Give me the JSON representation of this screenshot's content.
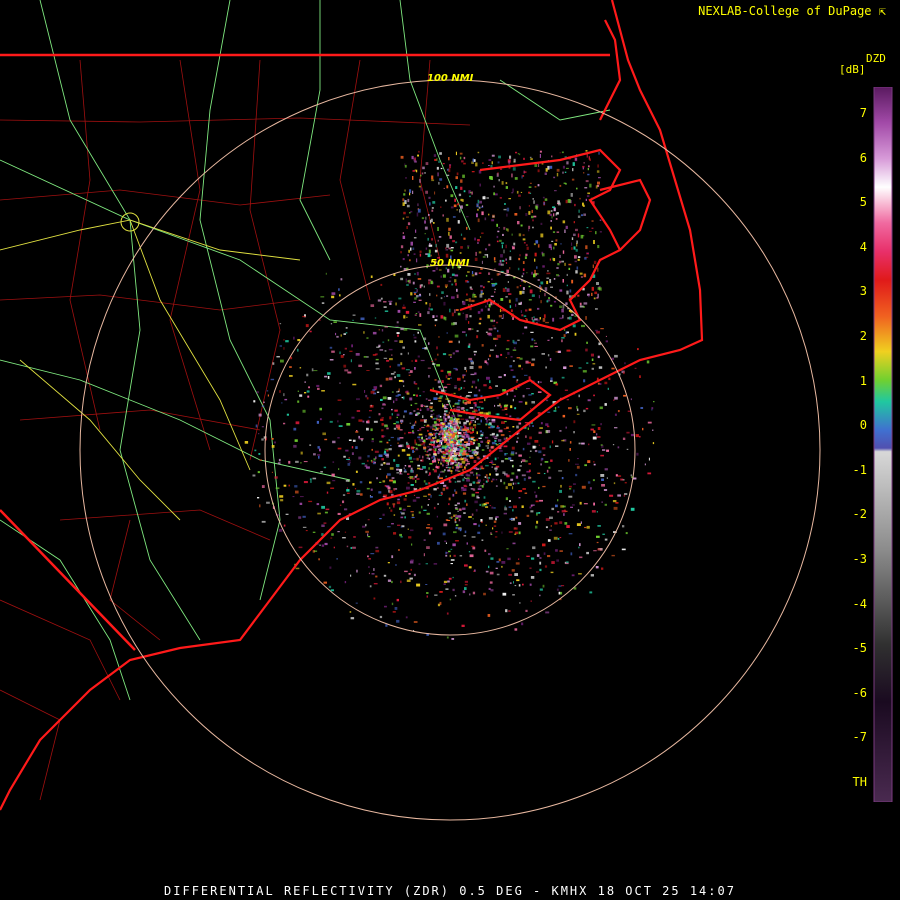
{
  "credit": "NEXLAB-College of DuPage",
  "credit_icon": "cursor-arrow-icon",
  "legend": {
    "title": "DZD",
    "unit": "[dB]",
    "ticks": [
      "7",
      "6",
      "5",
      "4",
      "3",
      "2",
      "1",
      "0",
      "-1",
      "-2",
      "-3",
      "-4",
      "-5",
      "-6",
      "-7",
      "TH"
    ],
    "colors": [
      "#6a1e6f",
      "#a24aa8",
      "#d79ad8",
      "#f2f2f2",
      "#f06aa0",
      "#e01a3a",
      "#d01818",
      "#f06020",
      "#f0d020",
      "#70d030",
      "#20c8a0",
      "#4060c0",
      "#c8c8c8",
      "#8a8a8a",
      "#404040",
      "#3a1a40"
    ]
  },
  "range_rings": {
    "inner": "50 NMI",
    "outer": "100 NMI"
  },
  "footer": "DIFFERENTIAL REFLECTIVITY (ZDR) 0.5 DEG - KMHX 18 OCT 25 14:07",
  "colors": {
    "coastline": "#ff1a1a",
    "counties": "#a01010",
    "highways": "#7fe87f",
    "rings": "#e8b8a0",
    "text": "#ffff00"
  }
}
